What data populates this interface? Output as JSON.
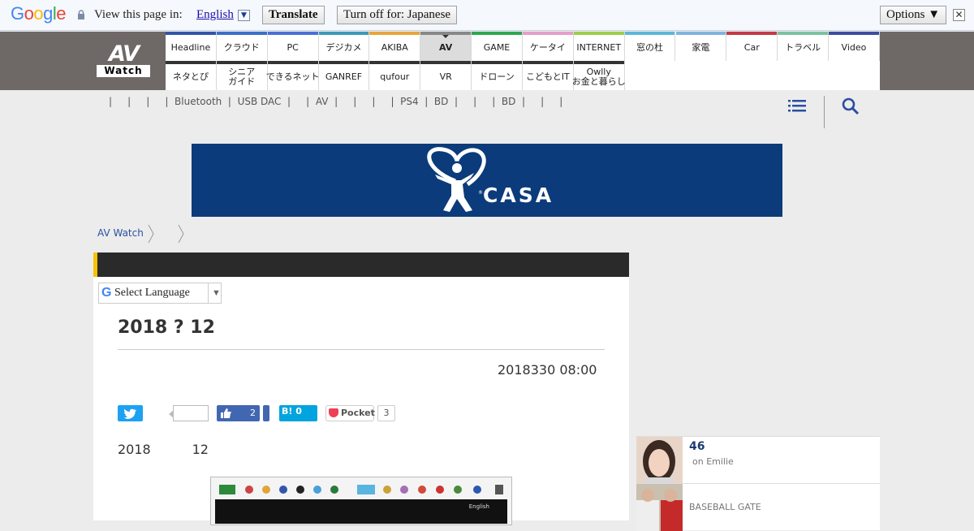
{
  "translate_bar": {
    "logo_letters": [
      {
        "ch": "G",
        "color": "#4285f4"
      },
      {
        "ch": "o",
        "color": "#ea4335"
      },
      {
        "ch": "o",
        "color": "#fbbc05"
      },
      {
        "ch": "g",
        "color": "#4285f4"
      },
      {
        "ch": "l",
        "color": "#34a853"
      },
      {
        "ch": "e",
        "color": "#ea4335"
      }
    ],
    "view_label": "View this page in:",
    "language": "English",
    "translate_button": "Translate",
    "turn_off_button": "Turn off for: Japanese",
    "options_button": "Options ▼",
    "close_glyph": "✕"
  },
  "header": {
    "logo_top": "AV",
    "logo_bottom": "Watch",
    "nav_row1": [
      {
        "label": "Headline",
        "color": "#3355aa"
      },
      {
        "label": "クラウド",
        "color": "#3a70c8"
      },
      {
        "label": "PC",
        "color": "#4b6fd8"
      },
      {
        "label": "デジカメ",
        "color": "#3d9ab8"
      },
      {
        "label": "AKIBA",
        "color": "#e8a53a"
      },
      {
        "label": "AV",
        "color": "#888888"
      },
      {
        "label": "GAME",
        "color": "#2fa84f"
      },
      {
        "label": "ケータイ",
        "color": "#e59fc7"
      },
      {
        "label": "INTERNET",
        "color": "#9ccf4a"
      },
      {
        "label": "窓の杜",
        "color": "#5cb8d9"
      },
      {
        "label": "家電",
        "color": "#7fb4e0"
      },
      {
        "label": "Car",
        "color": "#c33a45"
      },
      {
        "label": "トラベル",
        "color": "#7ac2a0"
      },
      {
        "label": "Video",
        "color": "#3c4ea0"
      }
    ],
    "nav_row2": [
      {
        "label": "ネタとぴ"
      },
      {
        "label": "シニア\nガイド"
      },
      {
        "label": "できるネット"
      },
      {
        "label": "GANREF"
      },
      {
        "label": "qufour"
      },
      {
        "label": "VR"
      },
      {
        "label": "ドローン"
      },
      {
        "label": "こどもとIT"
      },
      {
        "label": "Owlly\nお金と暮らし"
      }
    ],
    "sublinks": "|     |     |     |  Bluetooth  |  USB DAC  |     |  AV  |     |     |     |  PS4  |  BD  |     |     |  BD  |     |     |"
  },
  "banner": {
    "brand": "CASA",
    "colors": {
      "background": "#0b3b7a",
      "foreground": "#ffffff"
    }
  },
  "breadcrumb": {
    "home": "AV Watch"
  },
  "article": {
    "select_language": "Select Language",
    "select_arrow": "▼",
    "title": "2018 ? 12",
    "date": "2018330 08:00",
    "share": {
      "facebook_count": "2",
      "hatena": "B! 0",
      "pocket_label": "Pocket",
      "pocket_count": "3"
    },
    "body_line": "2018          12",
    "embedded_label": "English"
  },
  "sidebar": {
    "items": [
      {
        "num": "46",
        "sub": "on Emilie"
      },
      {
        "name": "BASEBALL GATE"
      }
    ]
  }
}
